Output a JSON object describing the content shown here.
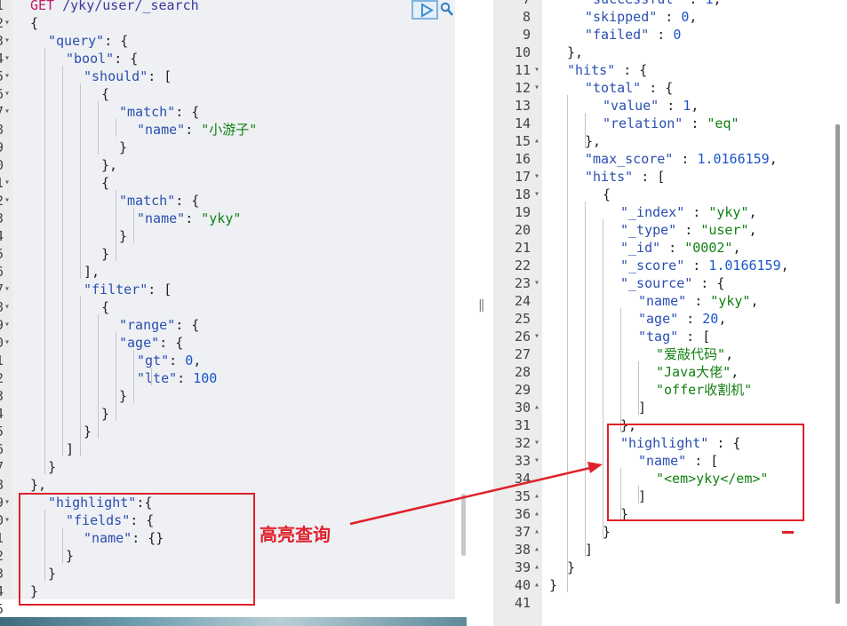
{
  "request": {
    "method": "GET",
    "path": "/yky/user/_search",
    "line_numbers": [
      "1",
      "2",
      "3",
      "4",
      "5",
      "6",
      "7",
      "8",
      "9",
      "0",
      "1",
      "2",
      "3",
      "4",
      "5",
      "6",
      "7",
      "8",
      "9",
      "0",
      "1",
      "2",
      "3",
      "4",
      "5",
      "6",
      "7",
      "8",
      "9",
      "0",
      "1",
      "2",
      "3",
      "4"
    ],
    "lines": [
      [
        "GET /yky/user/_search"
      ],
      [
        "{"
      ],
      [
        "\"query\": {"
      ],
      [
        "\"bool\": {"
      ],
      [
        "\"should\": ["
      ],
      [
        "{"
      ],
      [
        "\"match\": {"
      ],
      [
        "\"name\": \"小游子\""
      ],
      [
        "}"
      ],
      [
        "},"
      ],
      [
        "{"
      ],
      [
        "\"match\": {"
      ],
      [
        "\"name\": \"yky\""
      ],
      [
        "}"
      ],
      [
        "}"
      ],
      [
        "],"
      ],
      [
        "\"filter\": ["
      ],
      [
        "{"
      ],
      [
        "\"range\": {"
      ],
      [
        "\"age\": {"
      ],
      [
        "\"gt\": 0,"
      ],
      [
        "\"lte\": 100"
      ],
      [
        "}"
      ],
      [
        "}"
      ],
      [
        "}"
      ],
      [
        "]"
      ],
      [
        "}"
      ],
      [
        "},"
      ],
      [
        "\"highlight\":{"
      ],
      [
        "\"fields\": {"
      ],
      [
        "\"name\": {}"
      ],
      [
        "}"
      ],
      [
        "}"
      ],
      [
        "}"
      ]
    ],
    "extra_line_number": "5"
  },
  "response": {
    "line_numbers": [
      "7",
      "8",
      "9",
      "10",
      "11",
      "12",
      "13",
      "14",
      "15",
      "16",
      "17",
      "18",
      "19",
      "20",
      "21",
      "22",
      "23",
      "24",
      "25",
      "26",
      "27",
      "28",
      "29",
      "30",
      "31",
      "32",
      "33",
      "34",
      "35",
      "36",
      "37",
      "38",
      "39",
      "40",
      "41"
    ],
    "lines": [
      [
        "\"successful\" : 1,"
      ],
      [
        "\"skipped\" : 0,"
      ],
      [
        "\"failed\" : 0"
      ],
      [
        "},"
      ],
      [
        "\"hits\" : {"
      ],
      [
        "\"total\" : {"
      ],
      [
        "\"value\" : 1,"
      ],
      [
        "\"relation\" : \"eq\""
      ],
      [
        "},"
      ],
      [
        "\"max_score\" : 1.0166159,"
      ],
      [
        "\"hits\" : ["
      ],
      [
        "{"
      ],
      [
        "\"_index\" : \"yky\","
      ],
      [
        "\"_type\" : \"user\","
      ],
      [
        "\"_id\" : \"0002\","
      ],
      [
        "\"_score\" : 1.0166159,"
      ],
      [
        "\"_source\" : {"
      ],
      [
        "\"name\" : \"yky\","
      ],
      [
        "\"age\" : 20,"
      ],
      [
        "\"tag\" : ["
      ],
      [
        "\"爱敲代码\","
      ],
      [
        "\"Java大佬\","
      ],
      [
        "\"offer收割机\""
      ],
      [
        "]"
      ],
      [
        "},"
      ],
      [
        "\"highlight\" : {"
      ],
      [
        "\"name\" : ["
      ],
      [
        "\"<em>yky</em>\""
      ],
      [
        "]"
      ],
      [
        "}"
      ],
      [
        "}"
      ],
      [
        "]"
      ],
      [
        "}"
      ],
      [
        "}"
      ],
      [
        ""
      ]
    ]
  },
  "annotation": {
    "label": "高亮查询"
  },
  "colors": {
    "key": "#2a4fb0",
    "string": "#118011",
    "number": "#1a55cc",
    "method": "#c11b6a",
    "annotation_red": "#e0202a"
  },
  "icons": {
    "run": "play-icon",
    "settings": "wrench-icon"
  }
}
